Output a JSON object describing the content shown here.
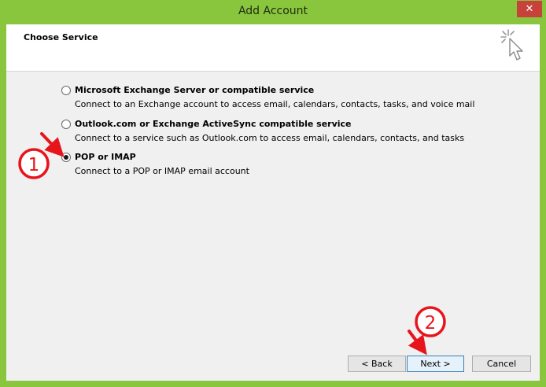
{
  "window": {
    "title": "Add Account",
    "close_label": "✕"
  },
  "header": {
    "title": "Choose Service",
    "icon": "cursor-sparkle-icon"
  },
  "options": [
    {
      "label": "Microsoft Exchange Server or compatible service",
      "description": "Connect to an Exchange account to access email, calendars, contacts, tasks, and voice mail",
      "selected": false
    },
    {
      "label": "Outlook.com or Exchange ActiveSync compatible service",
      "description": "Connect to a service such as Outlook.com to access email, calendars, contacts, and tasks",
      "selected": false
    },
    {
      "label": "POP or IMAP",
      "description": "Connect to a POP or IMAP email account",
      "selected": true
    }
  ],
  "buttons": {
    "back": "< Back",
    "next": "Next >",
    "cancel": "Cancel"
  },
  "annotations": {
    "step1": "1",
    "step2": "2",
    "color": "#e8141c"
  },
  "colors": {
    "frame": "#8ac53e",
    "close": "#c7423a"
  }
}
